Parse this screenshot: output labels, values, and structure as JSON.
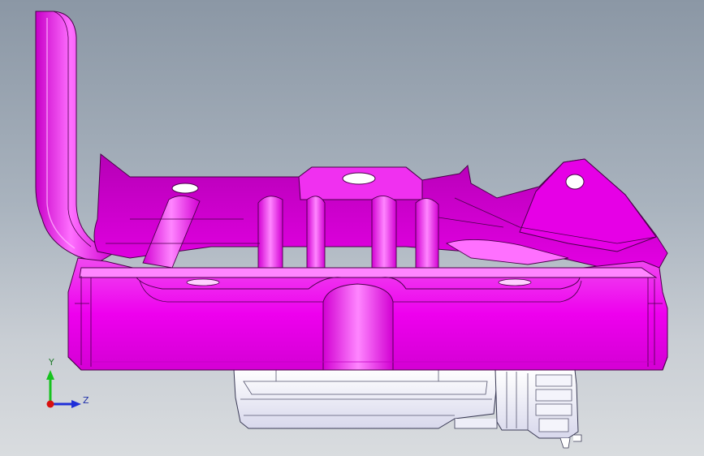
{
  "triad": {
    "y_label": "Y",
    "z_label": "Z",
    "colors": {
      "y": "#16c21e",
      "z": "#1f2fd8",
      "x": "#d81010"
    }
  },
  "model": {
    "part_color": "#ee00ee",
    "part_shade": "#b400b4",
    "part_highlight": "#ff7dff",
    "edge_color": "#4a004a",
    "assembly_color": "#e6e6f2",
    "assembly_edge": "#3a3a55"
  },
  "background": {
    "top": "#8b97a5",
    "bottom": "#d9dcdf"
  }
}
